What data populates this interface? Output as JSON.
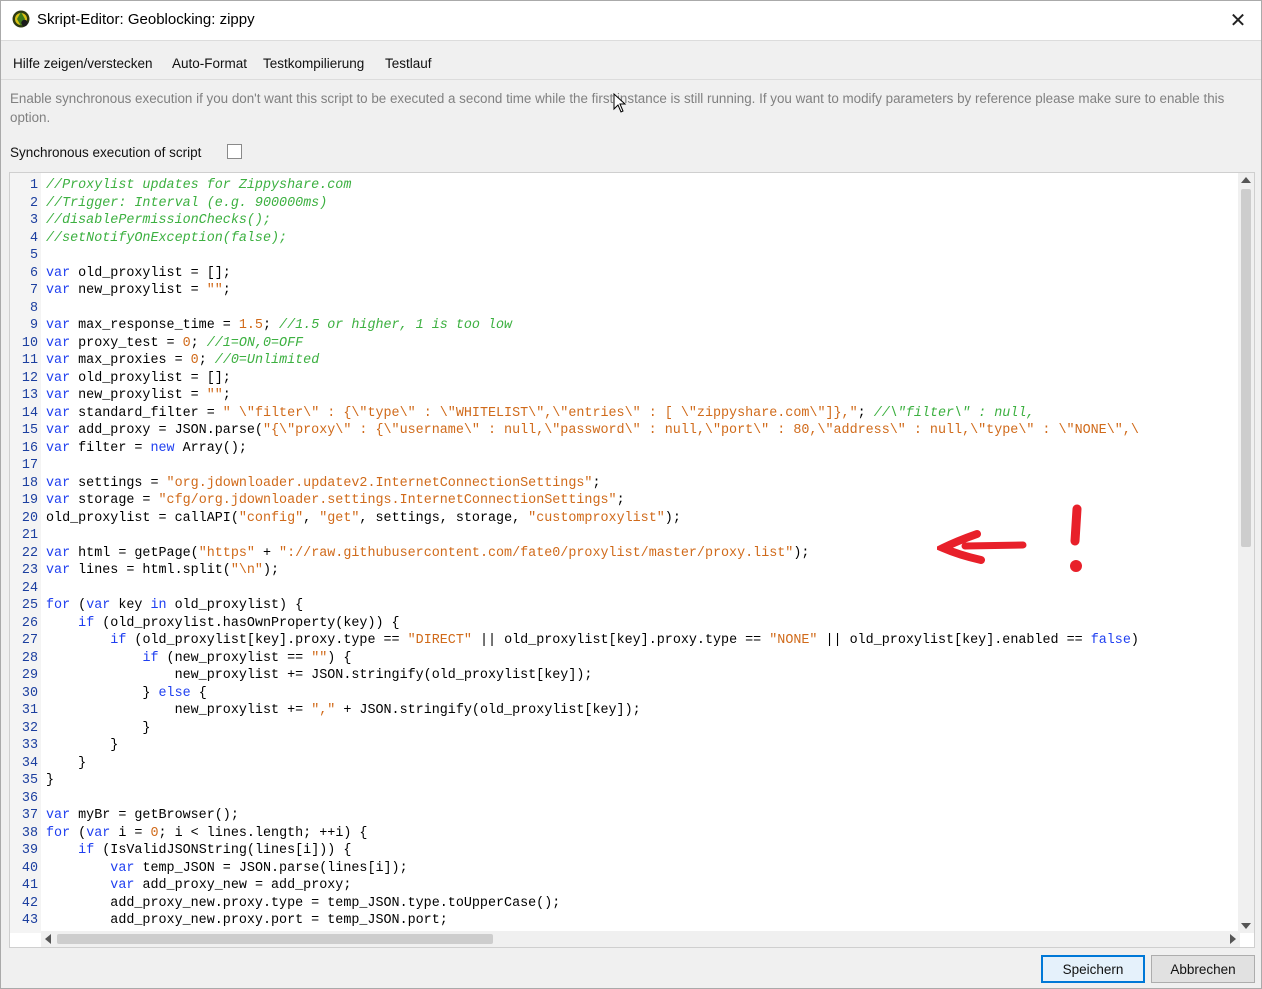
{
  "window": {
    "title": "Skript-Editor: Geoblocking: zippy",
    "close_glyph": "✕"
  },
  "menu": [
    {
      "label": "Hilfe zeigen/verstecken"
    },
    {
      "label": "Auto-Format"
    },
    {
      "label": "Testkompilierung"
    },
    {
      "label": "Testlauf"
    }
  ],
  "help_text": "Enable synchronous execution if you don't want this script to be executed a second time while the first instance is still running. If you want to modify parameters by reference please make sure to enable this option.",
  "sync_option": {
    "label": "Synchronous execution of script",
    "checked": false
  },
  "icons": [
    "app-logo-icon",
    "close-icon",
    "checkbox-icon",
    "arrow-annotation-icon",
    "mouse-cursor-icon"
  ],
  "colors": {
    "comment": "#3cb040",
    "keyword": "#1f3ff0",
    "string": "#d06a1a",
    "line_number": "#1c3f9f",
    "annotation": "#e8202a",
    "primary_button_border": "#0078d7"
  },
  "code_lines": [
    {
      "n": "1",
      "code": "//Proxylist updates for Zippyshare.com"
    },
    {
      "n": "2",
      "code": "//Trigger: Interval (e.g. 900000ms)"
    },
    {
      "n": "3",
      "code": "//disablePermissionChecks();"
    },
    {
      "n": "4",
      "code": "//setNotifyOnException(false);"
    },
    {
      "n": "5",
      "code": ""
    },
    {
      "n": "6",
      "code": "var old_proxylist = [];"
    },
    {
      "n": "7",
      "code": "var new_proxylist = \"\";"
    },
    {
      "n": "8",
      "code": ""
    },
    {
      "n": "9",
      "code": "var max_response_time = 1.5; //1.5 or higher, 1 is too low"
    },
    {
      "n": "10",
      "code": "var proxy_test = 0; //1=ON,0=OFF"
    },
    {
      "n": "11",
      "code": "var max_proxies = 0; //0=Unlimited"
    },
    {
      "n": "12",
      "code": "var old_proxylist = [];"
    },
    {
      "n": "13",
      "code": "var new_proxylist = \"\";"
    },
    {
      "n": "14",
      "code": "var standard_filter = \" \\\"filter\\\" : {\\\"type\\\" : \\\"WHITELIST\\\",\\\"entries\\\" : [ \\\"zippyshare.com\\\"]},\"; //\\\"filter\\\" : null,"
    },
    {
      "n": "15",
      "code": "var add_proxy = JSON.parse(\"{\\\"proxy\\\" : {\\\"username\\\" : null,\\\"password\\\" : null,\\\"port\\\" : 80,\\\"address\\\" : null,\\\"type\\\" : \\\"NONE\\\",\\"
    },
    {
      "n": "16",
      "code": "var filter = new Array();"
    },
    {
      "n": "17",
      "code": ""
    },
    {
      "n": "18",
      "code": "var settings = \"org.jdownloader.updatev2.InternetConnectionSettings\";"
    },
    {
      "n": "19",
      "code": "var storage = \"cfg/org.jdownloader.settings.InternetConnectionSettings\";"
    },
    {
      "n": "20",
      "code": "old_proxylist = callAPI(\"config\", \"get\", settings, storage, \"customproxylist\");"
    },
    {
      "n": "21",
      "code": ""
    },
    {
      "n": "22",
      "code": "var html = getPage(\"https\" + \"://raw.githubusercontent.com/fate0/proxylist/master/proxy.list\");"
    },
    {
      "n": "23",
      "code": "var lines = html.split(\"\\n\");"
    },
    {
      "n": "24",
      "code": ""
    },
    {
      "n": "25",
      "code": "for (var key in old_proxylist) {"
    },
    {
      "n": "26",
      "code": "    if (old_proxylist.hasOwnProperty(key)) {"
    },
    {
      "n": "27",
      "code": "        if (old_proxylist[key].proxy.type == \"DIRECT\" || old_proxylist[key].proxy.type == \"NONE\" || old_proxylist[key].enabled == false)"
    },
    {
      "n": "28",
      "code": "            if (new_proxylist == \"\") {"
    },
    {
      "n": "29",
      "code": "                new_proxylist += JSON.stringify(old_proxylist[key]);"
    },
    {
      "n": "30",
      "code": "            } else {"
    },
    {
      "n": "31",
      "code": "                new_proxylist += \",\" + JSON.stringify(old_proxylist[key]);"
    },
    {
      "n": "32",
      "code": "            }"
    },
    {
      "n": "33",
      "code": "        }"
    },
    {
      "n": "34",
      "code": "    }"
    },
    {
      "n": "35",
      "code": "}"
    },
    {
      "n": "36",
      "code": ""
    },
    {
      "n": "37",
      "code": "var myBr = getBrowser();"
    },
    {
      "n": "38",
      "code": "for (var i = 0; i < lines.length; ++i) {"
    },
    {
      "n": "39",
      "code": "    if (IsValidJSONString(lines[i])) {"
    },
    {
      "n": "40",
      "code": "        var temp_JSON = JSON.parse(lines[i]);"
    },
    {
      "n": "41",
      "code": "        var add_proxy_new = add_proxy;"
    },
    {
      "n": "42",
      "code": "        add_proxy_new.proxy.type = temp_JSON.type.toUpperCase();"
    },
    {
      "n": "43",
      "code": "        add_proxy_new.proxy.port = temp_JSON.port;"
    }
  ],
  "buttons": {
    "save": "Speichern",
    "cancel": "Abbrechen"
  }
}
